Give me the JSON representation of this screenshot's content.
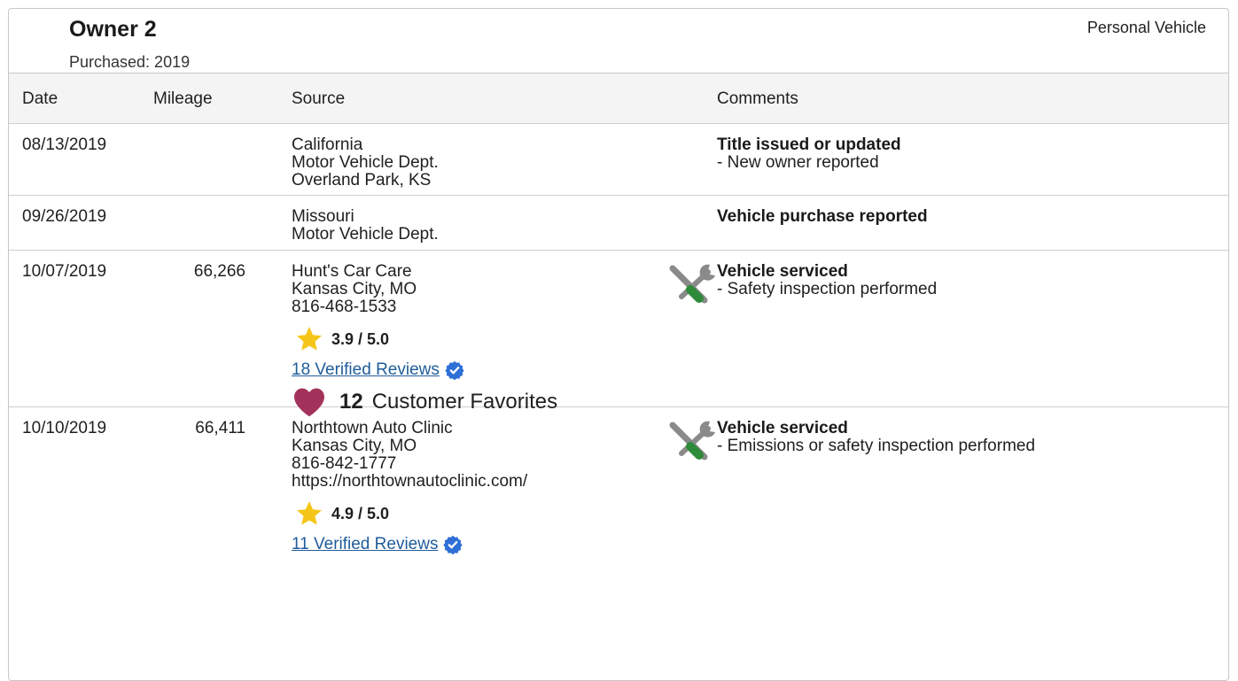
{
  "owner": {
    "title": "Owner 2",
    "purchased": "Purchased: 2019",
    "vehicle_type": "Personal Vehicle"
  },
  "table": {
    "headers": {
      "date": "Date",
      "mileage": "Mileage",
      "source": "Source",
      "comments": "Comments"
    },
    "rows": [
      {
        "date": "08/13/2019",
        "mileage": "",
        "source": [
          "California",
          "Motor Vehicle Dept.",
          "Overland Park, KS"
        ],
        "comment_title": "Title issued or updated",
        "comment_detail": "- New owner reported"
      },
      {
        "date": "09/26/2019",
        "mileage": "",
        "source": [
          "Missouri",
          "Motor Vehicle Dept."
        ],
        "comment_title": "Vehicle purchase reported",
        "comment_detail": ""
      },
      {
        "date": "10/07/2019",
        "mileage": "66,266",
        "source": [
          "Hunt's Car Care",
          "Kansas City, MO",
          "816-468-1533"
        ],
        "rating": "3.9 / 5.0",
        "reviews": "18 Verified Reviews",
        "favorites_count": "12",
        "favorites_label": "Customer Favorites",
        "comment_title": "Vehicle serviced",
        "comment_detail": "- Safety inspection performed",
        "icon": "service-tools-icon"
      },
      {
        "date": "10/10/2019",
        "mileage": "66,411",
        "source": [
          "Northtown Auto Clinic",
          "Kansas City, MO",
          "816-842-1777",
          "https://northtownautoclinic.com/"
        ],
        "rating": "4.9 / 5.0",
        "reviews": "11 Verified Reviews",
        "comment_title": "Vehicle serviced",
        "comment_detail": "- Emissions or safety inspection performed",
        "icon": "service-tools-icon"
      }
    ]
  },
  "icons": {
    "star": "star-icon",
    "verified": "verified-badge-icon",
    "heart": "heart-icon",
    "tools": "service-tools-icon"
  },
  "colors": {
    "star": "#f5c518",
    "heart": "#a3325a",
    "verified": "#2f6fd6",
    "link": "#1f5c9a",
    "wrench_gray": "#8a8a8a",
    "screwdriver_green": "#2e8b3a"
  }
}
